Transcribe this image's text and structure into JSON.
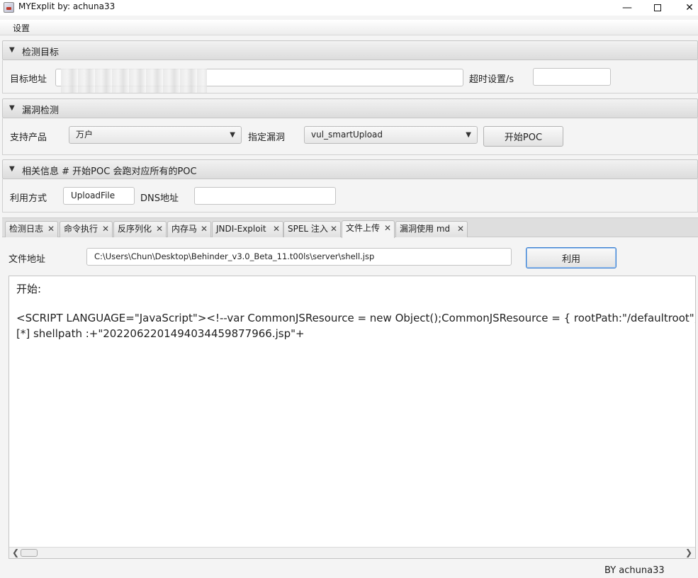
{
  "window": {
    "title": "MYExplit by: achuna33"
  },
  "menu": {
    "settings": "设置"
  },
  "target": {
    "header": "检测目标",
    "url_label": "目标地址",
    "url_value": "",
    "timeout_label": "超时设置/s",
    "timeout_value": ""
  },
  "vuln": {
    "header": "漏洞检测",
    "product_label": "支持产品",
    "product_value": "万户",
    "vuln_label": "指定漏洞",
    "vuln_value": "vul_smartUpload",
    "start_button": "开始POC"
  },
  "info": {
    "header": "相关信息 # 开始POC 会跑对应所有的POC",
    "method_label": "利用方式",
    "method_value": "UploadFile",
    "dns_label": "DNS地址",
    "dns_value": ""
  },
  "tabs": [
    {
      "label": "检测日志"
    },
    {
      "label": "命令执行"
    },
    {
      "label": "反序列化"
    },
    {
      "label": "内存马"
    },
    {
      "label": "JNDI-Exploit"
    },
    {
      "label": "SPEL 注入"
    },
    {
      "label": "文件上传"
    },
    {
      "label": "漏洞使用 md"
    }
  ],
  "upload": {
    "file_label": "文件地址",
    "file_value": "C:\\Users\\Chun\\Desktop\\Behinder_v3.0_Beta_11.t00ls\\server\\shell.jsp",
    "exploit_button": "利用"
  },
  "output": {
    "lines": [
      "开始:",
      "",
      "<SCRIPT LANGUAGE=\"JavaScript\"><!--var CommonJSResource = new Object();CommonJSResource = {  rootPath:\"/defaultroot\",",
      "[*] shellpath :+\"20220622014940344598779​66.jsp\"+"
    ]
  },
  "footer": {
    "credit": "BY   achuna33"
  }
}
